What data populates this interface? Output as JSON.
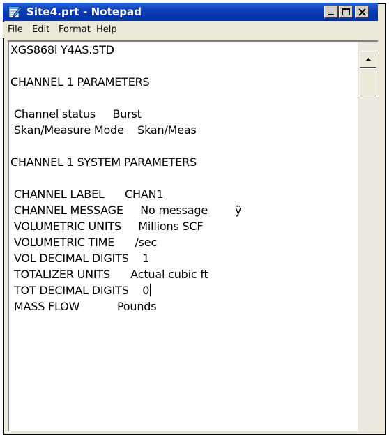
{
  "window": {
    "title": "Site4.prt - Notepad",
    "app_icon": "notepad-icon",
    "colors": {
      "titlebar": "#0b3cb3",
      "chrome": "#ece9d8",
      "editor_bg": "#ffffff",
      "text": "#000000"
    }
  },
  "caption_buttons": {
    "minimize": "minimize-icon",
    "maximize": "maximize-icon",
    "close": "close-icon"
  },
  "menu": {
    "file": "File",
    "edit": "Edit",
    "format": "Format",
    "help": "Help"
  },
  "document": {
    "lines": [
      "XGS868i Y4AS.STD",
      "",
      "CHANNEL 1 PARAMETERS",
      "",
      " Channel status     Burst",
      " Skan/Measure Mode    Skan/Meas",
      "",
      "CHANNEL 1 SYSTEM PARAMETERS",
      "",
      " CHANNEL LABEL      CHAN1",
      " CHANNEL MESSAGE     No message        ÿ",
      " VOLUMETRIC UNITS     Millions SCF",
      " VOLUMETRIC TIME      /sec",
      " VOL DECIMAL DIGITS    1",
      " TOTALIZER UNITS      Actual cubic ft",
      " TOT DECIMAL DIGITS    0",
      " MASS FLOW           Pounds"
    ],
    "caret_line_index": 15
  },
  "scrollbar": {
    "up_arrow": "arrow-up-icon"
  }
}
